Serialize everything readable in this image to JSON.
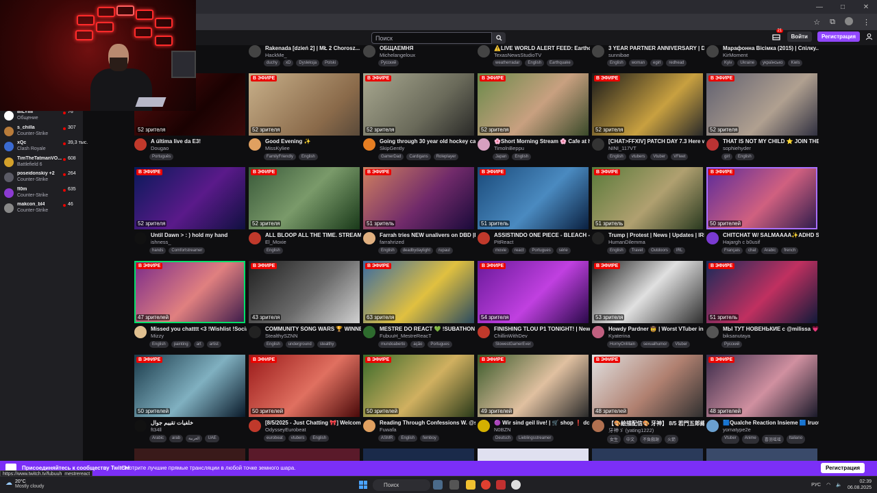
{
  "window": {
    "controls": [
      "—",
      "□",
      "✕"
    ]
  },
  "header": {
    "search_placeholder": "Поиск",
    "notif_count": "21",
    "login_label": "Войти",
    "signup_label": "Регистрация"
  },
  "sidebar": {
    "items": [
      {
        "name": "BILYIIII",
        "game": "Общение",
        "viewers": "76",
        "color": "#ffffff"
      },
      {
        "name": "s_chilla",
        "game": "Counter-Strike",
        "viewers": "307",
        "color": "#b87b3a"
      },
      {
        "name": "xQc",
        "game": "Clash Royale",
        "viewers": "39,3 тыс.",
        "color": "#3a6ad1"
      },
      {
        "name": "TimTheTatmanVO...",
        "game": "Battlefield 6",
        "viewers": "608",
        "color": "#d4a12b"
      },
      {
        "name": "poseidonskiy +2",
        "game": "Counter-Strike",
        "viewers": "264",
        "color": "#5b5b66"
      },
      {
        "name": "fl0m",
        "game": "Counter-Strike",
        "viewers": "635",
        "color": "#8b3ad1"
      },
      {
        "name": "makcon_bl4",
        "game": "Counter-Strike",
        "viewers": "46",
        "color": "#888888"
      }
    ]
  },
  "live_label": "В ЭФИРЕ",
  "partial_row": [
    {
      "title": "...ss",
      "user": "",
      "tags": [
        "games",
        "black"
      ]
    },
    {
      "title": "Rakenada [dzień 2] | MŁ 2 Chorosz...",
      "user": "HackMe_",
      "tags": [
        "duchy",
        "xD",
        "Dysleksja",
        "Polski"
      ]
    },
    {
      "title": "ОБЩАЕМНЯ",
      "user": "Michelangeloux",
      "tags": [
        "Русский"
      ]
    },
    {
      "title": "⚠️LIVE WORLD ALERT FEED: Earthq...",
      "user": "TexasNewsStudioTV",
      "tags": [
        "weatherradar",
        "English",
        "Earthquake"
      ]
    },
    {
      "title": "3 YEAR PARTNER ANNIVERSARY | Day 2...",
      "user": "sunnibae",
      "tags": [
        "English",
        "woman",
        "egirl",
        "redhead"
      ]
    },
    {
      "title": "Марафонна Вісімка (2015) | Спілку...",
      "user": "KirMoment",
      "tags": [
        "Kyiv",
        "Ukraine",
        "українсько",
        "Kiels"
      ]
    }
  ],
  "cards": [
    {
      "title": "A última live da E3!",
      "user": "Dougao",
      "viewers": "52 зрителя",
      "tags": [
        "Português"
      ],
      "av": "#c0392b"
    },
    {
      "title": "Good Evening ✨",
      "user": "MissKyliee",
      "viewers": "52 зрителя",
      "tags": [
        "FamilyFriendly",
        "English"
      ],
      "av": "#e0a060"
    },
    {
      "title": "Going through 30 year old hockey cards",
      "user": "SkipGently",
      "viewers": "52 зрителя",
      "tags": [
        "GamerDad",
        "Cardigans",
        "Roleplayer"
      ],
      "av": "#e67e22"
    },
    {
      "title": "🌸Short Morning Stream 🌸 Cafe at hom...",
      "user": "TimolnBeppu",
      "viewers": "52 зрителя",
      "tags": [
        "Japan",
        "English"
      ],
      "av": "#d7a0c0"
    },
    {
      "title": "[CHAT>FFXIV] PATCH DAY 7.3 Here we...",
      "user": "NINI_117VT",
      "viewers": "52 зрителя",
      "tags": [
        "English",
        "vtubers",
        "Vtuber",
        "VFleet"
      ],
      "av": "#333333"
    },
    {
      "title": "THAT IS NOT MY CHILD ⭐ JOIN THE H...",
      "user": "sophiehyder",
      "viewers": "52 зрителя",
      "tags": [
        "girl",
        "English"
      ],
      "av": "#b33"
    },
    {
      "title": "Until Dawn > : ) hold my hand",
      "user": "ishness_",
      "viewers": "52 зрителя",
      "tags": [
        "hands",
        "Comfortstreamer"
      ],
      "av": "#111"
    },
    {
      "title": "ALL BLOOP ALL THE TIME. STREAM RA...",
      "user": "El_Moxie",
      "viewers": "52 зрителя",
      "tags": [
        "English"
      ],
      "av": "#c0392b"
    },
    {
      "title": "Farrah tries NEW unalivers on DBD |DIS...",
      "user": "farrahrized",
      "viewers": "51 зритель",
      "tags": [
        "English",
        "deadbydaylight",
        "rupaul"
      ],
      "av": "#e0b080"
    },
    {
      "title": "ASSISTINDO ONE PIECE - BLEACH - DI...",
      "user": "PitReact",
      "viewers": "51 зритель",
      "tags": [
        "movie",
        "react",
        "Portugues",
        "série"
      ],
      "av": "#c0392b"
    },
    {
      "title": "Trump | Protest | News | Updates | IRL",
      "user": "HumanDilemma",
      "viewers": "51 зритель",
      "tags": [
        "English",
        "Travel",
        "Outdoors",
        "IRL"
      ],
      "av": "#222"
    },
    {
      "title": "CHITCHAT W/ SALMAAAA✨ADHD Str...",
      "user": "Hajargh с b0usif",
      "viewers": "50 зрителей",
      "tags": [
        "Français",
        "chat",
        "Arabic",
        "french"
      ],
      "av": "#7a3ad1"
    },
    {
      "title": "Missed you chatttt <3 !Wishlist !Social...",
      "user": "Mizzy",
      "viewers": "47 зрителей",
      "tags": [
        "English",
        "painting",
        "art",
        "artist"
      ],
      "av": "#e0c090"
    },
    {
      "title": "COMMUNITY SONG WARS 🏆 WINNER...",
      "user": "StealthySZNN",
      "viewers": "43 зрителя",
      "tags": [
        "English",
        "underground",
        "stealthy"
      ],
      "av": "#222"
    },
    {
      "title": "MESTRE DO REACT 💚 !SUBATHON 💚...",
      "user": "FubuuH_MestreReacT",
      "viewers": "63 зрителя",
      "tags": [
        "mundoaberto",
        "ação",
        "Portugues"
      ],
      "av": "#2e6b2e"
    },
    {
      "title": "FINISHING TLOU P1 TONIGHT! | New S...",
      "user": "ChillinWithDev",
      "viewers": "54 зрителя",
      "tags": [
        "SlowestGamerEver"
      ],
      "av": "#c0392b"
    },
    {
      "title": "Howdy Pardner 🤠 | Worst VTuber in al...",
      "user": "Kyaterina",
      "viewers": "53 зрителя",
      "tags": [
        "HornyOnMain",
        "sexualhumor",
        "Vtuber"
      ],
      "av": "#c06080"
    },
    {
      "title": "МЫ ТУТ НОВЕНЬКИЕ с @milissa 💗 !т...",
      "user": "biksanutaya",
      "viewers": "51 зритель",
      "tags": [
        "Русский"
      ],
      "av": "#555"
    },
    {
      "title": "خلفيات تقييم جوال",
      "user": "ft34ll",
      "viewers": "50 зрителей",
      "tags": [
        "Arabic",
        "arab",
        "العربية",
        "UAE"
      ],
      "av": "#111"
    },
    {
      "title": "[8/5/2025 - Just Chatting 🎀] Welcom...",
      "user": "OdysseyEurobeat",
      "viewers": "50 зрителей",
      "tags": [
        "eurobeat",
        "vtubers",
        "English"
      ],
      "av": "#c0392b"
    },
    {
      "title": "Reading Through Confessions W. @san...",
      "user": "Fuwafa",
      "viewers": "50 зрителей",
      "tags": [
        "ASMR",
        "English",
        "femboy"
      ],
      "av": "#e0a060"
    },
    {
      "title": "🟣 Wir sind geil live! | 🛒 shop ❗ dc ❗...",
      "user": "N0BZN",
      "viewers": "49 зрителей",
      "tags": [
        "Deutsch",
        "Lieblingsstreamer"
      ],
      "av": "#d4b000"
    },
    {
      "title": "【🎨絵描配信🎨 牙神】 8/5 若門五郎縁義...",
      "user": "牙神ゞ (yating1222)",
      "viewers": "48 зрителей",
      "tags": [
        "女生",
        "中文",
        "不負戲謝",
        "火箭"
      ],
      "av": "#b07050"
    },
    {
      "title": "🟦Qualche Reaction Insieme 🟦 Iruota ...",
      "user": "yomatype2e",
      "viewers": "48 зрителей",
      "tags": [
        "Vtuber",
        "Anime",
        "喜羽瑶瑶",
        "Italiano"
      ],
      "av": "#6aa0d0"
    }
  ],
  "banner": {
    "title": "Присоединяйтесь к сообществу Twitch!",
    "text": "Смотрите лучшие прямые трансляции в любой точке земного шара.",
    "button": "Регистрация"
  },
  "status_url": "https://www.twitch.tv/fubuuh_mestrereact",
  "taskbar": {
    "weather_temp": "20°C",
    "weather_desc": "Mostly cloudy",
    "search_label": "Поиск",
    "lang": "РУС",
    "time": "02:39",
    "date": "06.08.2025"
  }
}
